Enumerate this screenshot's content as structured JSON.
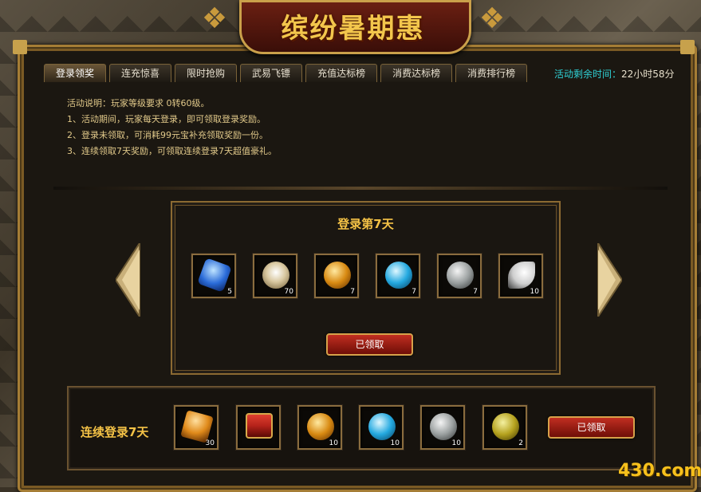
{
  "title": "缤纷暑期惠",
  "tabs": [
    "登录领奖",
    "连充惊喜",
    "限时抢购",
    "武易飞镖",
    "充值达标榜",
    "消费达标榜",
    "消费排行榜"
  ],
  "remaining": {
    "label": "活动剩余时间：",
    "value": "22小时58分"
  },
  "description": [
    "活动说明：玩家等级要求 0转60级。",
    "1、活动期间，玩家每天登录，即可领取登录奖励。",
    "2、登录未领取，可消耗99元宝补充领取奖励一份。",
    "3、连续领取7天奖励，可领取连续登录7天超值豪礼。"
  ],
  "panel": {
    "title": "登录第7天",
    "items": [
      {
        "icon": "blue-crystal-icon",
        "count": "5",
        "color": "#2a6bd8"
      },
      {
        "icon": "pearl-shell-icon",
        "count": "70",
        "color": "#d9c8a0"
      },
      {
        "icon": "gold-orb-icon",
        "count": "7",
        "color": "#d88a12"
      },
      {
        "icon": "blue-orb-icon",
        "count": "7",
        "color": "#24a9e0"
      },
      {
        "icon": "silver-dragon-orb-icon",
        "count": "7",
        "color": "#9ba0a0"
      },
      {
        "icon": "white-wing-icon",
        "count": "10",
        "color": "#e8e8e8"
      }
    ],
    "button": "已领取"
  },
  "bottom": {
    "label": "连续登录7天",
    "items": [
      {
        "icon": "orange-crystal-icon",
        "count": "30",
        "color": "#e08a1a"
      },
      {
        "icon": "red-treasure-chest-icon",
        "count": "",
        "color": "#b4221a"
      },
      {
        "icon": "gold-orb-icon",
        "count": "10",
        "color": "#d88a12"
      },
      {
        "icon": "blue-orb-icon",
        "count": "10",
        "color": "#24a9e0"
      },
      {
        "icon": "silver-dragon-orb-icon",
        "count": "10",
        "color": "#9ba0a0"
      },
      {
        "icon": "jade-coin-icon",
        "count": "2",
        "color": "#b5a21e"
      }
    ],
    "button": "已领取"
  },
  "logo": "430.com"
}
